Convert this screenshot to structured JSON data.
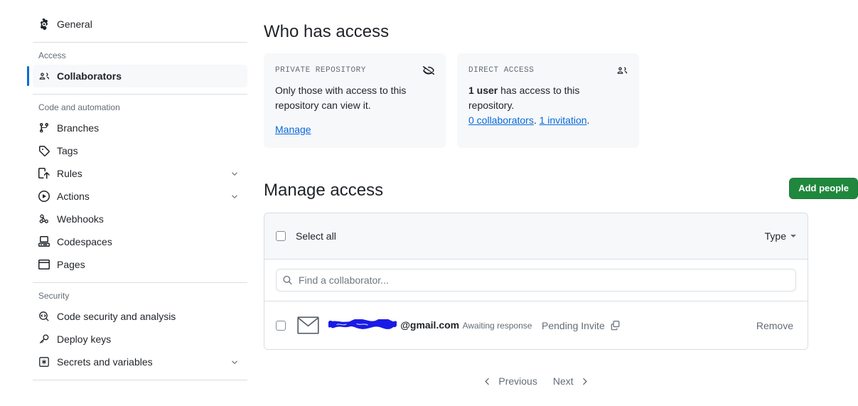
{
  "sidebar": {
    "top_items": [
      {
        "label": "General",
        "icon": "gear-icon",
        "name": "general",
        "chevron": false,
        "active": false
      }
    ],
    "groups": [
      {
        "title": "Access",
        "items": [
          {
            "label": "Collaborators",
            "icon": "people-icon",
            "name": "collaborators",
            "chevron": false,
            "active": true
          }
        ]
      },
      {
        "title": "Code and automation",
        "items": [
          {
            "label": "Branches",
            "icon": "git-branch-icon",
            "name": "branches",
            "chevron": false,
            "active": false
          },
          {
            "label": "Tags",
            "icon": "tag-icon",
            "name": "tags",
            "chevron": false,
            "active": false
          },
          {
            "label": "Rules",
            "icon": "rules-icon",
            "name": "rules",
            "chevron": true,
            "active": false
          },
          {
            "label": "Actions",
            "icon": "play-icon",
            "name": "actions",
            "chevron": true,
            "active": false
          },
          {
            "label": "Webhooks",
            "icon": "webhook-icon",
            "name": "webhooks",
            "chevron": false,
            "active": false
          },
          {
            "label": "Codespaces",
            "icon": "codespaces-icon",
            "name": "codespaces",
            "chevron": false,
            "active": false
          },
          {
            "label": "Pages",
            "icon": "browser-icon",
            "name": "pages",
            "chevron": false,
            "active": false
          }
        ]
      },
      {
        "title": "Security",
        "items": [
          {
            "label": "Code security and analysis",
            "icon": "code-search-icon",
            "name": "code-security-and-analysis",
            "chevron": false,
            "active": false
          },
          {
            "label": "Deploy keys",
            "icon": "key-icon",
            "name": "deploy-keys",
            "chevron": false,
            "active": false
          },
          {
            "label": "Secrets and variables",
            "icon": "asterisk-box-icon",
            "name": "secrets-and-variables",
            "chevron": true,
            "active": false
          }
        ]
      }
    ]
  },
  "who_has_access": {
    "title": "Who has access",
    "cards": [
      {
        "eyebrow": "PRIVATE REPOSITORY",
        "icon": "eye-closed-icon",
        "body": "Only those with access to this repository can view it.",
        "action_label": "Manage"
      },
      {
        "eyebrow": "DIRECT ACCESS",
        "icon": "people-icon",
        "body_strong": "1 user",
        "body_rest": " has access to this repository.",
        "link_collaborators": "0 collaborators",
        "link_separator": ". ",
        "link_invitation": "1 invitation",
        "body_end": "."
      }
    ]
  },
  "manage_access": {
    "title": "Manage access",
    "add_people_label": "Add people",
    "select_all_label": "Select all",
    "type_filter_label": "Type",
    "search_placeholder": "Find a collaborator...",
    "search_value": "",
    "rows": [
      {
        "avatar_icon": "envelope-icon",
        "email_redacted": true,
        "email_domain": "@gmail.com",
        "status_sub": "Awaiting response",
        "pending_label": "Pending Invite",
        "copy_icon": "copy-icon",
        "remove_label": "Remove"
      }
    ],
    "pagination": {
      "previous_label": "Previous",
      "next_label": "Next"
    }
  },
  "colors": {
    "accent": "#0969da",
    "success_button": "#1f883d",
    "surface_subtle": "#f6f8fa",
    "border": "#d8dee4",
    "text_muted": "#636c76",
    "redaction": "#1a1ae6"
  }
}
